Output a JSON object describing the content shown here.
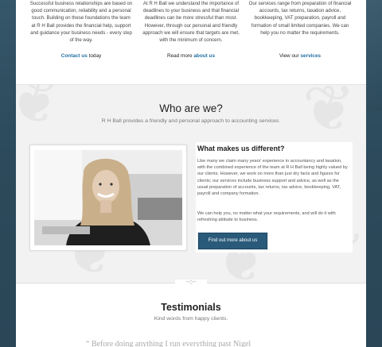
{
  "columns": [
    {
      "text": "Successful business relationships are based on good communication, reliability and a personal touch. Building on these foundations the team at R H Ball provides the financial help, support and guidance your business needs - every step of the way.",
      "cta_link": "Contact us",
      "cta_rest": " today"
    },
    {
      "text": "At R H Ball we understand the importance of deadlines to your business and that financial deadlines can be more stressful than most. However, through our personal and friendly approach we will ensure that targets are met, with the minimum of concern.",
      "cta_pre": "Read more ",
      "cta_link": "about us"
    },
    {
      "text": "Our services range from preparation of financial accounts, tax returns, taxation advice, bookkeeping, VAT preparation, payroll and formation of small limited companies. We can help you no matter the requirements.",
      "cta_pre": "View our ",
      "cta_link": "services"
    }
  ],
  "who": {
    "heading": "Who are we?",
    "subheading": "R H Ball provides a friendly and personal approach to accounting services.",
    "box_title": "What makes us different?",
    "para1": "Like many we claim many years' experience in accountancy and taxation, with the combined experience of the team at R H Ball being highly valued by our clients. However, we work on more than just dry facts and figures for clients; our services include business support and advice, as well as the usual preparation of accounts, tax returns, tax advice, bookkeeping, VAT, payroll and company formation.",
    "para2": "We can help you, no matter what your requirements, and will do it with refreshing attitude to business.",
    "button": "Find out more about us"
  },
  "testimonials": {
    "heading": "Testimonials",
    "subheading": "Kind words from happy clients.",
    "quote_start": "“ Before doing anything I run everything past Nigel"
  }
}
